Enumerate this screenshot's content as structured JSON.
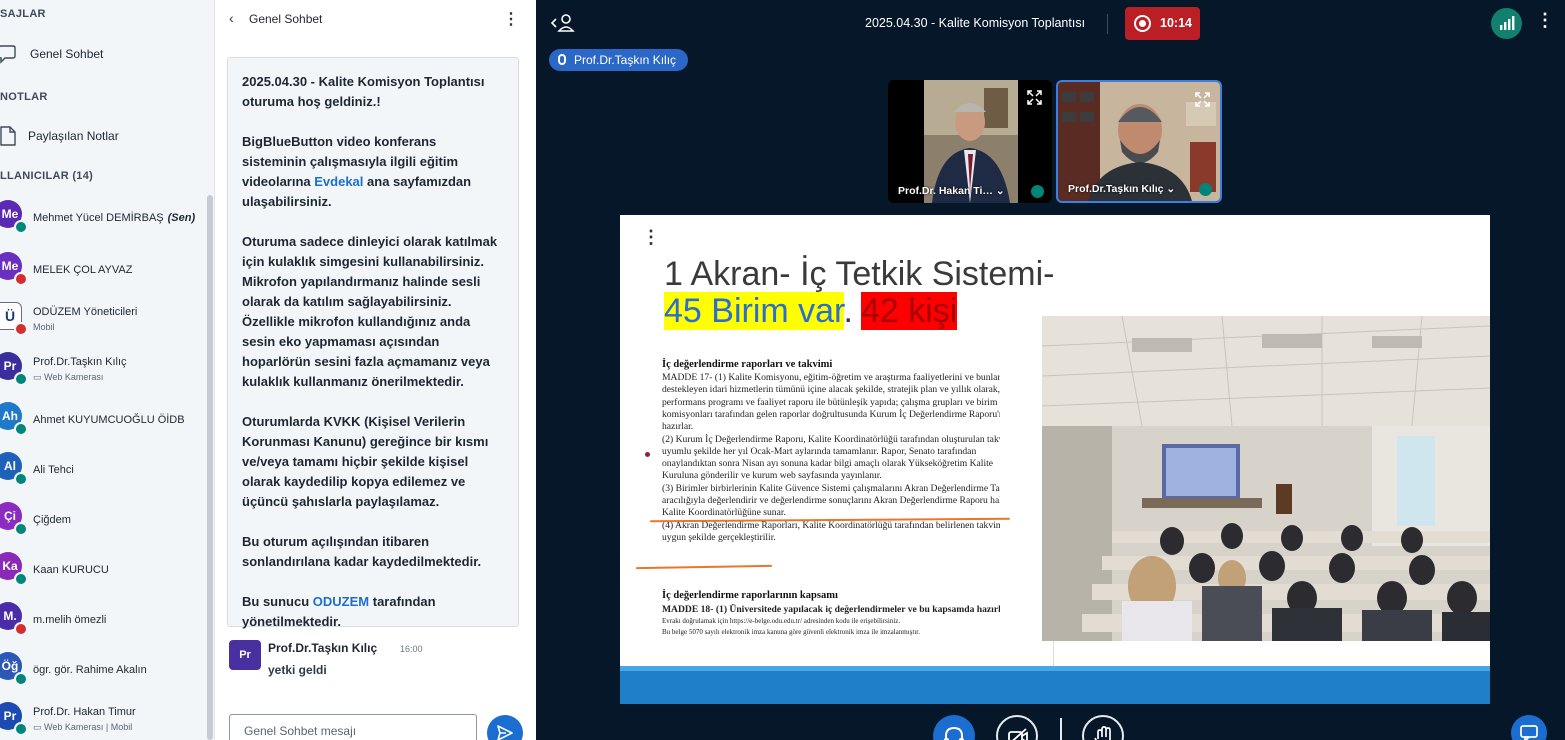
{
  "sidebar": {
    "messages_title": "SAJLAR",
    "public_chat_label": "Genel Sohbet",
    "notes_title": "NOTLAR",
    "shared_notes_label": "Paylaşılan Notlar",
    "users_title": "LLANICILAR (14)",
    "users": [
      {
        "initials": "Me",
        "name": "Mehmet Yücel DEMİRBAŞ",
        "you": "(Sen)",
        "sub": "",
        "color": "#5b2ab5",
        "mic": "on"
      },
      {
        "initials": "Me",
        "name": "MELEK ÇOL AYVAZ",
        "sub": "",
        "color": "#6a2fc0",
        "mic": "off"
      },
      {
        "initials": "Ü",
        "name": "ODÜZEM Yöneticileri",
        "sub": "Mobil",
        "color": "#ffffff",
        "mic": "off"
      },
      {
        "initials": "Pr",
        "name": "Prof.Dr.Taşkın Kılıç",
        "sub": "Web Kamerası",
        "color": "#3a2e9c",
        "mic": "on"
      },
      {
        "initials": "Ah",
        "name": "Ahmet KUYUMCUOĞLU ÖİDB",
        "sub": "",
        "color": "#1f78c8",
        "mic": "on"
      },
      {
        "initials": "Al",
        "name": "Ali Tehci",
        "sub": "",
        "color": "#1d61b8",
        "mic": "on"
      },
      {
        "initials": "Çi",
        "name": "Çiğdem",
        "sub": "",
        "color": "#8b2bbf",
        "mic": "on"
      },
      {
        "initials": "Ka",
        "name": "Kaan KURUCU",
        "sub": "",
        "color": "#8a28b8",
        "mic": "on"
      },
      {
        "initials": "M.",
        "name": "m.melih ömezli",
        "sub": "",
        "color": "#4b2ca8",
        "mic": "off"
      },
      {
        "initials": "Öğ",
        "name": "ögr. gör. Rahime Akalın",
        "sub": "",
        "color": "#2d57b5",
        "mic": "on"
      },
      {
        "initials": "Pr",
        "name": "Prof.Dr. Hakan Timur",
        "sub": "Web Kamerası | Mobil",
        "color": "#1d4ab0",
        "mic": "on"
      }
    ]
  },
  "chat": {
    "title": "Genel Sohbet",
    "welcome": {
      "p1": "2025.04.30 - Kalite Komisyon Toplantısı oturuma hoş geldiniz.!",
      "p2_pre": "BigBlueButton video konferans sisteminin çalışmasıyla ilgili eğitim videolarına ",
      "p2_link": "Evdekal",
      "p2_post": " ana sayfamızdan ulaşabilirsiniz.",
      "p3": "Oturuma sadece dinleyici olarak katılmak için kulaklık simgesini kullanabilirsiniz. Mikrofon yapılandırmanız halinde sesli olarak da katılım sağlayabilirsiniz. Özellikle mikrofon kullandığınız anda sesin eko yapmaması açısından hoparlörün sesini fazla açmamanız veya kulaklık kullanmanız önerilmektedir.",
      "p4": "Oturumlarda KVKK (Kişisel Verilerin Korunması Kanunu) gereğince bir kısmı ve/veya tamamı hiçbir şekilde kişisel olarak kaydedilip kopya edilemez ve üçüncü şahıslarla paylaşılamaz.",
      "p5": "Bu oturum açılışından itibaren sonlandırılana kadar kaydedilmektedir.",
      "p6_pre": "Bu sunucu ",
      "p6_link": "ODUZEM",
      "p6_post": " tarafından yönetilmektedir."
    },
    "message": {
      "avatar": "Pr",
      "author": "Prof.Dr.Taşkın Kılıç",
      "time": "16:00",
      "text": "yetki geldi"
    },
    "input_placeholder": "Genel Sohbet mesajı"
  },
  "meeting": {
    "title": "2025.04.30 - Kalite Komisyon Toplantısı",
    "recording_time": "10:14",
    "talking_indicator": "Prof.Dr.Taşkın Kılıç",
    "cams": [
      {
        "label": "Prof.Dr. Hakan Ti… ⌄"
      },
      {
        "label": "Prof.Dr.Taşkın Kılıç ⌄"
      }
    ]
  },
  "slide": {
    "title_line1": "1 Akran- İç Tetkik Sistemi-",
    "title_hl_a": "45 Birim var",
    "title_sep": ".",
    "title_hl_b": "42 kişi",
    "doc_heading1": "İç değerlendirme raporları ve takvimi",
    "doc_lines": [
      "MADDE 17- (1) Kalite Komisyonu, eğitim-öğretim ve araştırma faaliyetlerini ve bunları",
      "destekleyen idari hizmetlerin tümünü içine alacak şekilde, stratejik plan ve yıllık olarak,",
      "performans programı ve faaliyet raporu ile bütünleşik yapıda; çalışma grupları ve birim kalite",
      "komisyonları tarafından gelen raporlar doğrultusunda Kurum İç Değerlendirme Raporu'nu",
      "hazırlar.",
      "(2) Kurum İç Değerlendirme Raporu, Kalite Koordinatörlüğü tarafından oluşturulan takvimle",
      "uyumlu şekilde her yıl Ocak-Mart aylarında tamamlanır. Rapor, Senato tarafından",
      "onaylandıktan sonra Nisan ayı sonuna kadar bilgi amaçlı olarak Yükseköğretim Kalite",
      "Kuruluna gönderilir ve kurum web sayfasında yayınlanır.",
      "(3) Birimler birbirlerinin Kalite Güvence Sistemi çalışmalarını Akran Değerlendirme Takımları",
      "aracılığıyla değerlendirir ve değerlendirme sonuçlarını Akran Değerlendirme Raporu halinde",
      "Kalite Koordinatörlüğüne sunar.",
      "(4) Akran Değerlendirme Raporları, Kalite Koordinatörlüğü tarafından belirlenen takvime",
      "uygun şekilde gerçekleştirilir."
    ],
    "doc_heading2": "İç değerlendirme raporlarının kapsamı",
    "doc_line_last": "MADDE 18- (1) Üniversitede yapılacak iç değerlendirmeler ve bu kapsamda hazırlanacak",
    "doc_footer1": "Bu belge 5070 sayılı elektronik imza kanuna göre güvenli elektronik imza ile imzalanmıştır.",
    "doc_footer2": "Evrakı doğrulamak için https://e-belge.odu.edu.tr/ adresinden kodu ile erişebilirsiniz."
  },
  "colors": {
    "accent": "#1b6ecf",
    "recording": "#b91f24",
    "mic_on": "#00857a",
    "mic_off": "#d32f2f"
  }
}
